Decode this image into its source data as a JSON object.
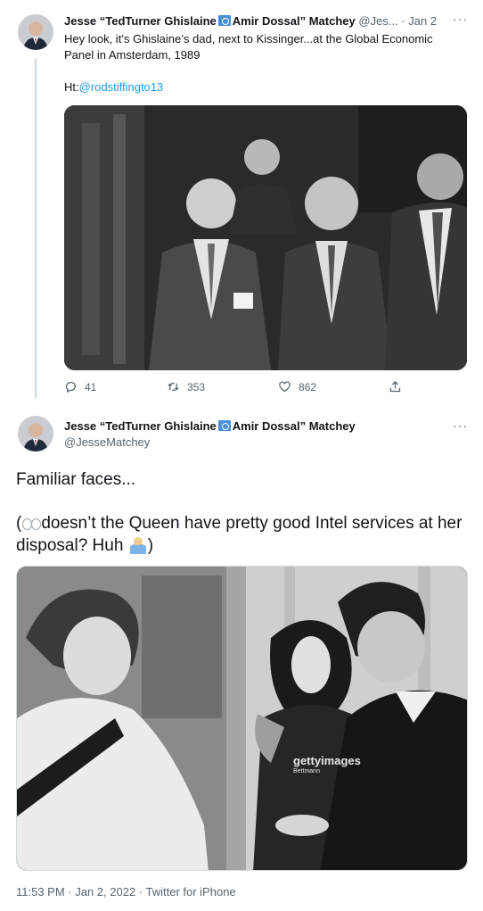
{
  "tweet1": {
    "display_name": "Jesse “TedTurner Ghislaine",
    "display_name_suffix": "Amir Dossal” Matchey",
    "handle": "@Jes...",
    "separator": "·",
    "date": "Jan 2",
    "text": "Hey look, it’s Ghislaine’s dad, next to Kissinger...at the Global Economic Panel in Amsterdam, 1989",
    "ht_prefix": "Ht:",
    "ht_link": "@rodstiffingto13",
    "photo_icon": "black-and-white-photo",
    "actions": {
      "reply_count": "41",
      "retweet_count": "353",
      "like_count": "862"
    }
  },
  "tweet2": {
    "display_name": "Jesse “TedTurner Ghislaine",
    "display_name_suffix": "Amir Dossal” Matchey",
    "handle": "@JesseMatchey",
    "text_line1": "Familiar faces...",
    "text_open": "(",
    "text_body": "doesn’t the Queen have pretty good Intel services at her disposal? Huh",
    "text_close": ")",
    "watermark": "gettyimages",
    "watermark_sub": "Bettmann",
    "timestamp": "11:53 PM · Jan 2, 2022 · Twitter for iPhone"
  },
  "colors": {
    "link": "#1d9bf0",
    "secondary_text": "#536471",
    "primary_text": "#0f1419",
    "thread_line": "#cfd9de",
    "flag_blue": "#4a90d9"
  },
  "icons": [
    "reply-icon",
    "retweet-icon",
    "like-icon",
    "share-icon",
    "more-icon",
    "flag-icon",
    "eyes-emoji",
    "shrug-emoji"
  ]
}
